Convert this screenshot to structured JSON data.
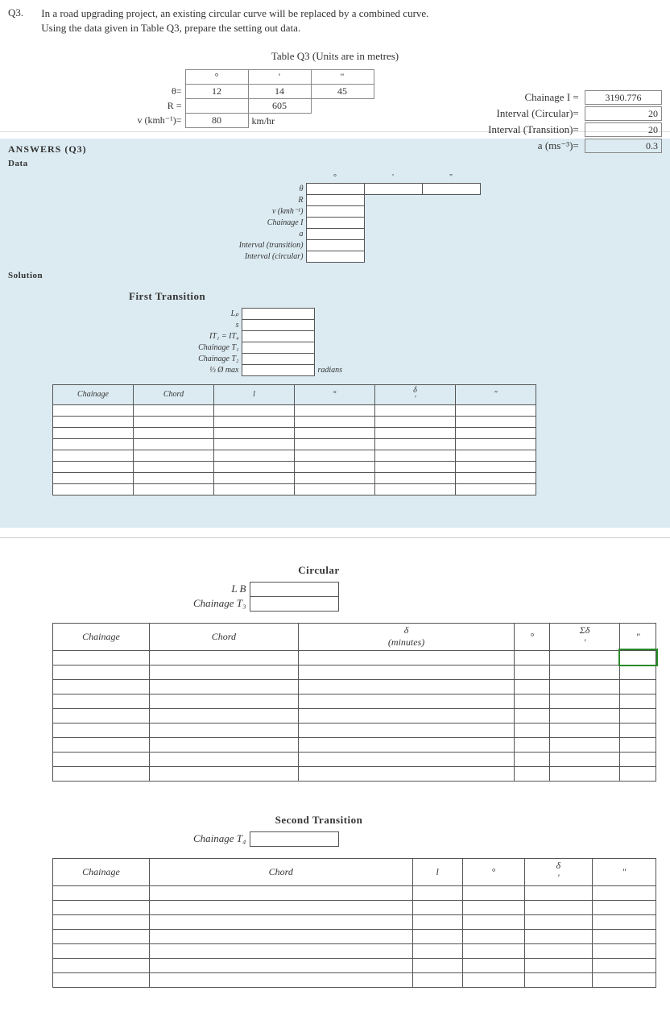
{
  "question": {
    "number": "Q3.",
    "line1": "In a road upgrading project, an existing circular curve will be replaced by a combined curve.",
    "line2": "Using the data given in Table Q3, prepare the setting out data."
  },
  "table_caption": "Table Q3  (Units are in metres)",
  "inputs": {
    "header_deg": "°",
    "header_min": "'",
    "header_sec": "\"",
    "theta_label": "θ=",
    "theta_deg": "12",
    "theta_min": "14",
    "theta_sec": "45",
    "R_label": "R =",
    "R_value": "605",
    "v_label": "v (kmh⁻¹)=",
    "v_value": "80",
    "v_unit": "km/hr"
  },
  "right": {
    "chainage_i_label": "Chainage I =",
    "chainage_i_value": "3190.776",
    "interval_circ_label": "Interval (Circular)=",
    "interval_circ_value": "20",
    "interval_trans_label": "Interval (Transition)=",
    "interval_trans_value": "20",
    "a_label": "a (ms⁻³)=",
    "a_value": "0.3"
  },
  "answers": {
    "heading": "ANSWERS (Q3)",
    "data_label": "Data",
    "solution_label": "Solution",
    "data_rows": {
      "theta": "θ",
      "R": "R",
      "v": "v (kmh⁻¹)",
      "CI": "Chainage I",
      "a": "a",
      "it": "Interval (transition)",
      "ic": "Interval (circular)"
    },
    "first_trans": {
      "heading": "First Transition",
      "Lp": "Lₚ",
      "s": "s",
      "IT": "IT₁ = IT₄",
      "CT1": "Chainage T₁",
      "CT2": "Chainage T₂",
      "phi": "⅓ Ø max",
      "phi_unit": "radians"
    },
    "grid1_headers": {
      "chainage": "Chainage",
      "chord": "Chord",
      "l": "l",
      "deg": "°",
      "delta": "δ\n'",
      "sec": "\""
    }
  },
  "circular": {
    "heading": "Circular",
    "LB": "L B",
    "CT3": "Chainage T₃",
    "grid_headers": {
      "chainage": "Chainage",
      "chord": "Chord",
      "delta": "δ\n(minutes)",
      "deg": "°",
      "sigma": "Σδ\n'",
      "sec": "\""
    }
  },
  "second": {
    "heading": "Second Transition",
    "CT4": "Chainage T₄",
    "grid_headers": {
      "chainage": "Chainage",
      "chord": "Chord",
      "l": "l",
      "deg": "°",
      "delta": "δ\n'",
      "sec": "\""
    }
  }
}
